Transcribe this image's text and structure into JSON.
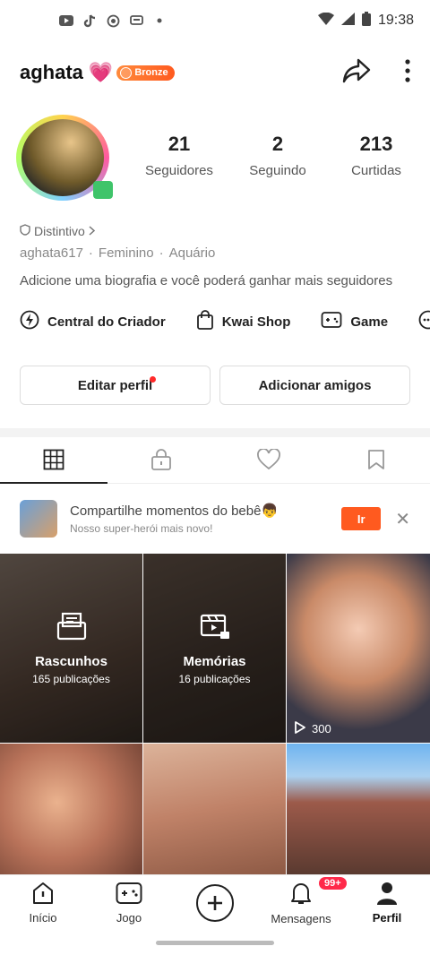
{
  "status_bar": {
    "time": "19:38",
    "left_icons": [
      "youtube-icon",
      "tiktok-icon",
      "record-icon",
      "chat-icon",
      "dot-icon"
    ],
    "right_icons": [
      "wifi-icon",
      "signal-icon",
      "battery-icon"
    ]
  },
  "header": {
    "username": "aghata",
    "emoji": "💗",
    "badge_label": "Bronze",
    "share_icon": "share-arrow-icon",
    "more_icon": "more-vertical-icon"
  },
  "stats": [
    {
      "value": "21",
      "label": "Seguidores"
    },
    {
      "value": "2",
      "label": "Seguindo"
    },
    {
      "value": "213",
      "label": "Curtidas"
    }
  ],
  "profile": {
    "distintivo": "Distintivo",
    "handle": "aghata617",
    "gender": "Feminino",
    "sign": "Aquário",
    "separator": "·",
    "bio": "Adicione uma biografia e você poderá ganhar mais seguidores"
  },
  "tools": [
    {
      "label": "Central do Criador",
      "icon": "bolt-circle-icon"
    },
    {
      "label": "Kwai Shop",
      "icon": "shopping-bag-icon"
    },
    {
      "label": "Game",
      "icon": "gamepad-icon"
    }
  ],
  "buttons": {
    "edit": "Editar perfil",
    "add_friends": "Adicionar amigos"
  },
  "tabs": [
    "grid-icon",
    "lock-icon",
    "heart-icon",
    "bookmark-icon"
  ],
  "promo": {
    "title": "Compartilhe momentos do bebê👦",
    "subtitle": "Nosso super-herói mais novo!",
    "action": "Ir",
    "close": "✕"
  },
  "grid": {
    "drafts": {
      "title": "Rascunhos",
      "count": "165 publicações"
    },
    "memories": {
      "title": "Memórias",
      "count": "16 publicações"
    },
    "views": "300"
  },
  "bottom_nav": [
    {
      "label": "Início",
      "icon": "home-icon"
    },
    {
      "label": "Jogo",
      "icon": "gamepad-icon"
    },
    {
      "label": "",
      "icon": "plus-circle-icon"
    },
    {
      "label": "Mensagens",
      "icon": "bell-icon",
      "badge": "99+"
    },
    {
      "label": "Perfil",
      "icon": "person-icon"
    }
  ],
  "colors": {
    "accent": "#ff5a1f",
    "badge_red": "#ff2a4a",
    "text": "#222222"
  }
}
